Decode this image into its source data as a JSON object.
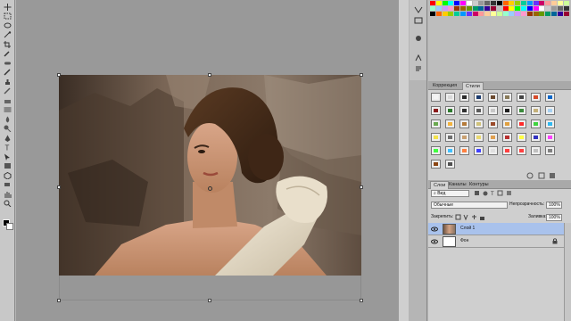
{
  "app": {
    "brand_color": "#cfcfcf",
    "canvas_bg": "#999999"
  },
  "toolbar": {
    "tools": [
      {
        "name": "move-tool-icon",
        "glyph": "move"
      },
      {
        "name": "marquee-tool-icon",
        "glyph": "marquee"
      },
      {
        "name": "lasso-tool-icon",
        "glyph": "lasso"
      },
      {
        "name": "magic-wand-tool-icon",
        "glyph": "wand"
      },
      {
        "name": "crop-tool-icon",
        "glyph": "crop"
      },
      {
        "name": "eyedropper-tool-icon",
        "glyph": "dropper"
      },
      {
        "name": "healing-brush-tool-icon",
        "glyph": "heal"
      },
      {
        "name": "brush-tool-icon",
        "glyph": "brush"
      },
      {
        "name": "clone-stamp-tool-icon",
        "glyph": "stamp"
      },
      {
        "name": "history-brush-tool-icon",
        "glyph": "history"
      },
      {
        "name": "eraser-tool-icon",
        "glyph": "eraser"
      },
      {
        "name": "gradient-tool-icon",
        "glyph": "gradient"
      },
      {
        "name": "blur-tool-icon",
        "glyph": "blur"
      },
      {
        "name": "dodge-tool-icon",
        "glyph": "dodge"
      },
      {
        "name": "pen-tool-icon",
        "glyph": "pen"
      },
      {
        "name": "type-tool-icon",
        "glyph": "type"
      },
      {
        "name": "path-selection-tool-icon",
        "glyph": "path"
      },
      {
        "name": "shape-tool-icon",
        "glyph": "shape"
      },
      {
        "name": "3d-rotate-tool-icon",
        "glyph": "3d"
      },
      {
        "name": "3d-camera-tool-icon",
        "glyph": "3dcam"
      },
      {
        "name": "hand-tool-icon",
        "glyph": "hand"
      },
      {
        "name": "zoom-tool-icon",
        "glyph": "zoom"
      }
    ],
    "foreground_color": "#000000",
    "background_color": "#ffffff"
  },
  "panels": {
    "styles_tabs": [
      "Коррекция",
      "Стили"
    ],
    "layers_tabs": [
      "Слои",
      "Каналы",
      "Контуры"
    ],
    "kind_filter": "Вид",
    "blend_mode": "Обычные",
    "opacity_label": "Непрозрачность:",
    "opacity_value": "100%",
    "lock_label": "Закрепить:",
    "fill_label": "Заливка:",
    "fill_value": "100%",
    "layers": [
      {
        "name": "Слой 1",
        "selected": true
      },
      {
        "name": "Фон",
        "selected": false
      }
    ]
  },
  "swatches": [
    "#ff0000",
    "#ffff00",
    "#00ff00",
    "#00ffff",
    "#0000ff",
    "#ff00ff",
    "#ffffff",
    "#cccccc",
    "#999999",
    "#666666",
    "#333333",
    "#000000",
    "#ff6600",
    "#ffcc00",
    "#99cc00",
    "#00cc99",
    "#0099ff",
    "#6633ff",
    "#cc0066",
    "#ff9999",
    "#ffcc99",
    "#ffff99",
    "#ccff99",
    "#99ffcc",
    "#99ccff",
    "#cc99ff",
    "#ff99cc",
    "#993300",
    "#996600",
    "#669900",
    "#009966",
    "#006699",
    "#330099",
    "#990033",
    "#c0c0c0"
  ],
  "styles": [
    "#f4f4f4",
    "#d9d9d9",
    "#2a2a2a",
    "#1b3b6f",
    "#6b4a2f",
    "#8a7b5a",
    "#444444",
    "#d64a2a",
    "#0a66c8",
    "#8b1a1a",
    "#2d7a2d",
    "#2f2f2f",
    "#5a5a5a",
    "#c8c8c8",
    "#1e1e1e",
    "#3a8a3a",
    "#c4b07a",
    "#a7d0f0",
    "#6aa84f",
    "#f3b33d",
    "#b57b3a",
    "#d0c27a",
    "#9a4a2a",
    "#e0a040",
    "#ff2a2a",
    "#3fd33f",
    "#2fb8f0",
    "#f2e24a",
    "#6e6e6e",
    "#c9a070",
    "#e8d870",
    "#e0a050",
    "#b83030",
    "#ffff40",
    "#3030c0",
    "#ff40ff",
    "#40ff40",
    "#40c0ff",
    "#ff8040",
    "#4040ff",
    "#e0e0e0",
    "#ff4040",
    "#ff4040",
    "#c0c0c0",
    "#808080",
    "#8b4513",
    "#505050"
  ]
}
